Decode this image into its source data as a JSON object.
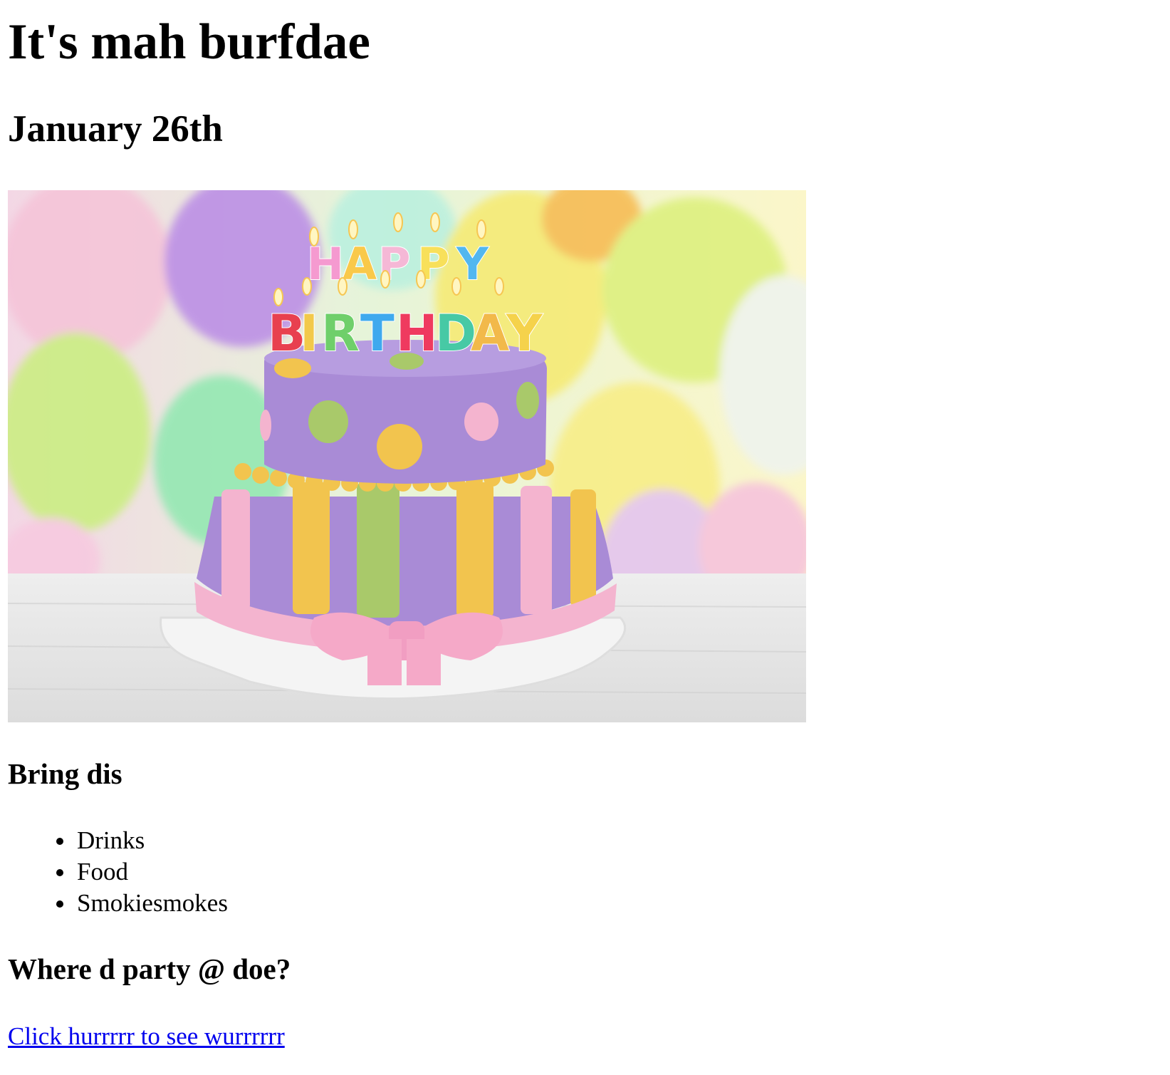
{
  "page": {
    "title": "It's mah burfdae",
    "date": "January 26th"
  },
  "image": {
    "subject": "birthday-cake-photo",
    "candle_text": [
      "HAPPY",
      "BIRTHDAY"
    ],
    "colors": {
      "purple": "#a98bd6",
      "pink": "#f4b4cf",
      "yellow": "#f2c44e",
      "green": "#a9c96a"
    }
  },
  "bring": {
    "heading": "Bring dis",
    "items": [
      "Drinks",
      "Food",
      "Smokiesmokes"
    ]
  },
  "location": {
    "heading": "Where d party @ doe?",
    "link_text": "Click hurrrrr to see wurrrrrr",
    "link_color": "#0000ee"
  }
}
